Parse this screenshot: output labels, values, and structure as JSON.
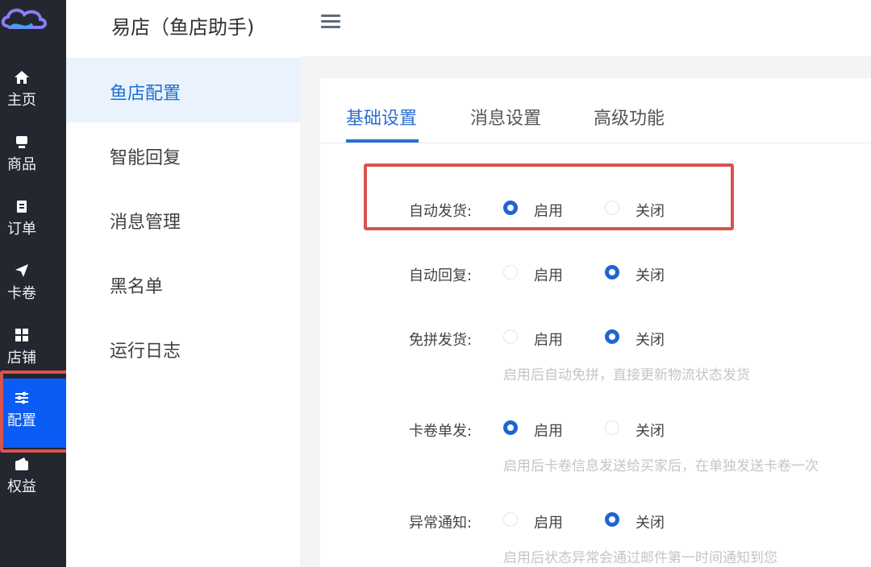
{
  "rail": {
    "items": [
      {
        "label": "主页",
        "icon": "home-icon"
      },
      {
        "label": "商品",
        "icon": "box-icon"
      },
      {
        "label": "订单",
        "icon": "clipboard-icon"
      },
      {
        "label": "卡卷",
        "icon": "paper-plane-icon"
      },
      {
        "label": "店铺",
        "icon": "grid-icon"
      },
      {
        "label": "配置",
        "icon": "sliders-icon"
      },
      {
        "label": "权益",
        "icon": "wallet-icon"
      }
    ],
    "active": "配置"
  },
  "app_title": "易店（鱼店助手)",
  "submenu": {
    "items": [
      "鱼店配置",
      "智能回复",
      "消息管理",
      "黑名单",
      "运行日志"
    ],
    "active": "鱼店配置"
  },
  "tabs": {
    "items": [
      "基础设置",
      "消息设置",
      "高级功能"
    ],
    "active": "基础设置"
  },
  "settings": [
    {
      "label": "自动发货:",
      "enable": "启用",
      "disable": "关闭",
      "value": "启用",
      "hint": ""
    },
    {
      "label": "自动回复:",
      "enable": "启用",
      "disable": "关闭",
      "value": "关闭",
      "hint": ""
    },
    {
      "label": "免拼发货:",
      "enable": "启用",
      "disable": "关闭",
      "value": "关闭",
      "hint": "启用后自动免拼，直接更新物流状态发货"
    },
    {
      "label": "卡卷单发:",
      "enable": "启用",
      "disable": "关闭",
      "value": "启用",
      "hint": "启用后卡卷信息发送给买家后，在单独发送卡卷一次"
    },
    {
      "label": "异常通知:",
      "enable": "启用",
      "disable": "关闭",
      "value": "关闭",
      "hint": "启用后状态异常会通过邮件第一时间通知到您"
    }
  ],
  "colors": {
    "accent": "#1f64d2",
    "rail_bg": "#23272f",
    "rail_active": "#0a5cf5",
    "highlight_box": "#d9534f"
  }
}
